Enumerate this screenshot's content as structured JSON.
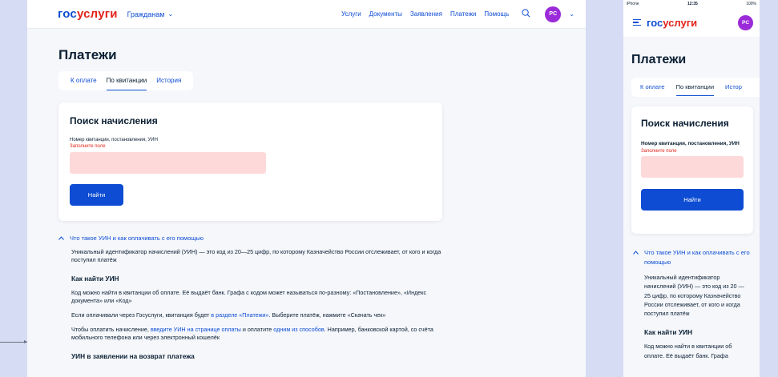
{
  "desktop": {
    "header": {
      "logo_part1": "гос",
      "logo_part2": "услуги",
      "role_label": "Гражданам",
      "nav": [
        "Услуги",
        "Документы",
        "Заявления",
        "Платежи",
        "Помощь"
      ],
      "avatar_initials": "PC"
    },
    "page_title": "Платежи",
    "tabs": [
      {
        "label": "К оплате",
        "active": false
      },
      {
        "label": "По квитанции",
        "active": true
      },
      {
        "label": "История",
        "active": false
      }
    ],
    "search_card": {
      "title": "Поиск начисления",
      "field_label": "Номер квитанции, постановления, УИН",
      "field_error": "Заполните поле",
      "field_value": "",
      "button_label": "Найти"
    },
    "faq": {
      "question": "Что такое УИН и как оплачивать с его помощью",
      "intro": "Уникальный идентификатор начислений (УИН) — это код из 20—25 цифр, по которому Казначейство России отслеживает, от кого и когда поступил платёж",
      "how_title": "Как найти УИН",
      "how_text": "Код можно найти в квитанции об оплате. Её выдаёт банк. Графа с кодом может называться по-разному: «Постановление», «Индекс документа» или «Код»",
      "gosuslugi_pre": "Если оплачивали через Госуслуги, квитанция будет ",
      "gosuslugi_link": "в разделе «Платежи»",
      "gosuslugi_post": ". Выберите платёж, нажмите «Скачать чек»",
      "pay_pre": "Чтобы оплатить начисление, ",
      "pay_link1": "введите УИН на странице оплаты",
      "pay_mid": " и оплатите ",
      "pay_link2": "одним из способов",
      "pay_post": ". Например, банковской картой, со счёта мобильного телефона или через электронный кошелёк",
      "refund_title": "УИН в заявлении на возврат платежа"
    }
  },
  "mobile": {
    "status": {
      "carrier": "iPhone",
      "time": "12:35",
      "battery": "100%"
    },
    "logo_part1": "гос",
    "logo_part2": "услуги",
    "avatar_initials": "PC",
    "page_title": "Платежи",
    "tabs": [
      {
        "label": "К оплате",
        "active": false
      },
      {
        "label": "По квитанции",
        "active": true
      },
      {
        "label": "Истор",
        "active": false
      }
    ],
    "search_card": {
      "title": "Поиск начисления",
      "field_label": "Номер квитанции, постановления, УИН",
      "field_error": "Заполните поле",
      "button_label": "Найти"
    },
    "faq": {
      "question": "Что такое УИН и как оплачивать с его помощью",
      "intro": "Уникальный идентификатор начислений (УИН) — это код из 20 —25 цифр, по которому Казначейство России отслеживает, от кого и когда поступил платёж",
      "how_title": "Как найти УИН",
      "how_text": "Код можно найти в квитанции об оплате. Её выдаёт банк. Графа"
    }
  },
  "colors": {
    "accent": "#0d4cd3",
    "error": "#e2231a",
    "avatar": "#9b2ad8",
    "error_field": "#fdd9da"
  }
}
